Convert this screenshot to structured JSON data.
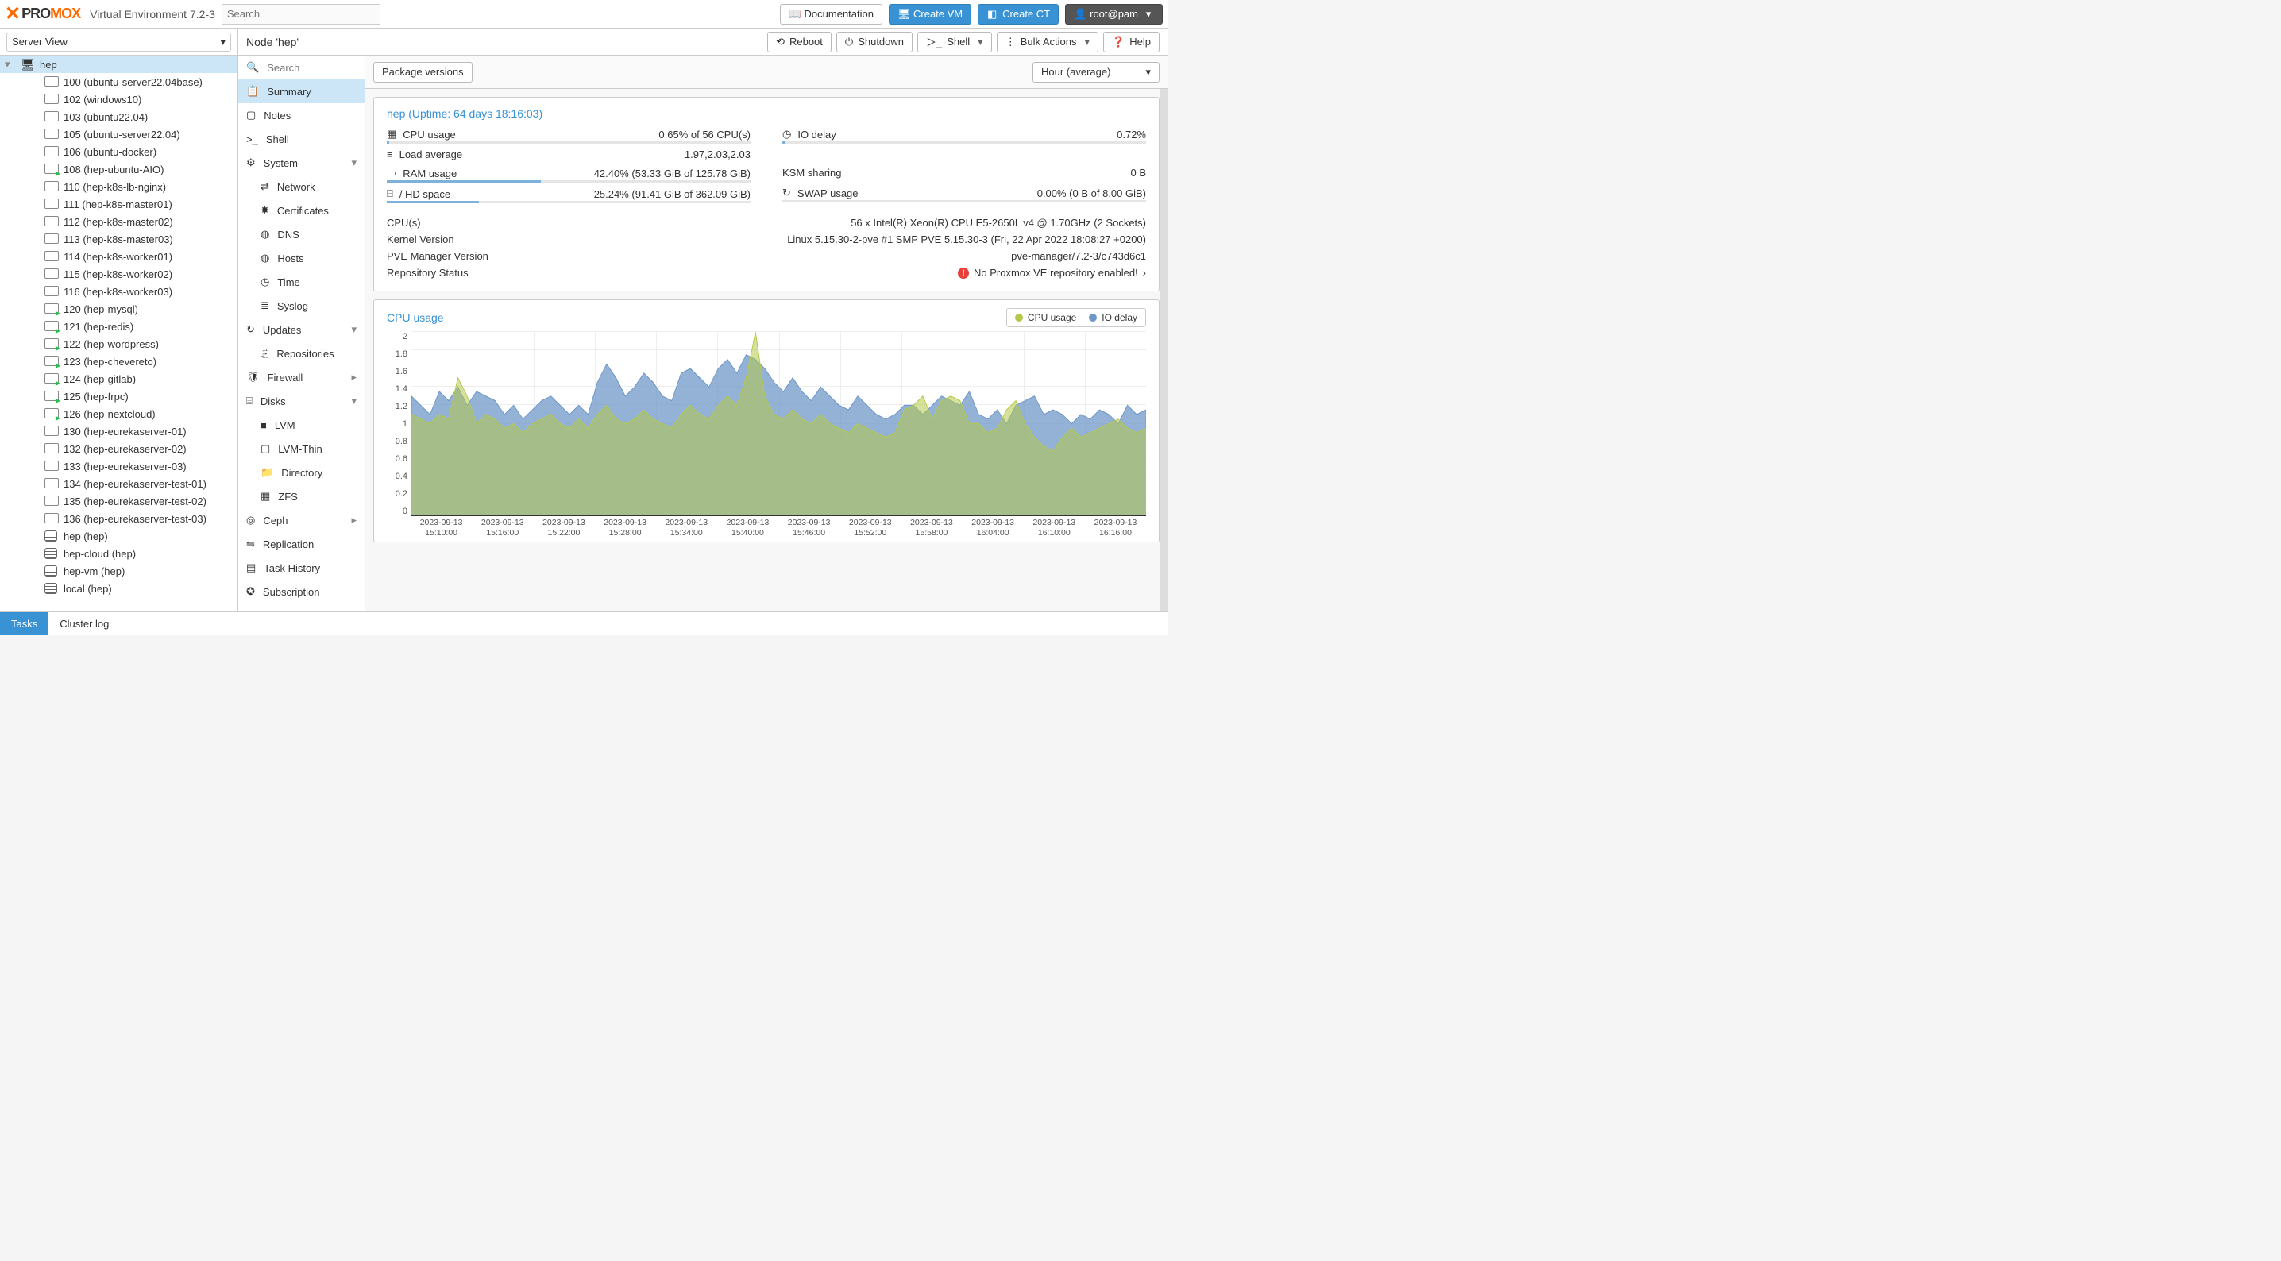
{
  "header": {
    "brand_prox": "PRO",
    "brand_mox": "MOX",
    "product": "Virtual Environment 7.2-3",
    "search_placeholder": "Search",
    "btn_docs": "Documentation",
    "btn_create_vm": "Create VM",
    "btn_create_ct": "Create CT",
    "btn_user": "root@pam"
  },
  "viewbar": {
    "view_select": "Server View",
    "node_title": "Node 'hep'",
    "btn_reboot": "Reboot",
    "btn_shutdown": "Shutdown",
    "btn_shell": "Shell",
    "btn_bulk": "Bulk Actions",
    "btn_help": "Help"
  },
  "tree": {
    "root": "hep",
    "items": [
      {
        "label": "100 (ubuntu-server22.04base)",
        "running": false,
        "type": "vm"
      },
      {
        "label": "102 (windows10)",
        "running": false,
        "type": "vm"
      },
      {
        "label": "103 (ubuntu22.04)",
        "running": false,
        "type": "vm"
      },
      {
        "label": "105 (ubuntu-server22.04)",
        "running": false,
        "type": "vm"
      },
      {
        "label": "106 (ubuntu-docker)",
        "running": false,
        "type": "vm"
      },
      {
        "label": "108 (hep-ubuntu-AIO)",
        "running": true,
        "type": "vm"
      },
      {
        "label": "110 (hep-k8s-lb-nginx)",
        "running": false,
        "type": "vm"
      },
      {
        "label": "111 (hep-k8s-master01)",
        "running": false,
        "type": "vm"
      },
      {
        "label": "112 (hep-k8s-master02)",
        "running": false,
        "type": "vm"
      },
      {
        "label": "113 (hep-k8s-master03)",
        "running": false,
        "type": "vm"
      },
      {
        "label": "114 (hep-k8s-worker01)",
        "running": false,
        "type": "vm"
      },
      {
        "label": "115 (hep-k8s-worker02)",
        "running": false,
        "type": "vm"
      },
      {
        "label": "116 (hep-k8s-worker03)",
        "running": false,
        "type": "vm"
      },
      {
        "label": "120 (hep-mysql)",
        "running": true,
        "type": "vm"
      },
      {
        "label": "121 (hep-redis)",
        "running": true,
        "type": "vm"
      },
      {
        "label": "122 (hep-wordpress)",
        "running": true,
        "type": "vm"
      },
      {
        "label": "123 (hep-chevereto)",
        "running": true,
        "type": "vm"
      },
      {
        "label": "124 (hep-gitlab)",
        "running": true,
        "type": "vm"
      },
      {
        "label": "125 (hep-frpc)",
        "running": true,
        "type": "vm"
      },
      {
        "label": "126 (hep-nextcloud)",
        "running": true,
        "type": "vm"
      },
      {
        "label": "130 (hep-eurekaserver-01)",
        "running": false,
        "type": "vm"
      },
      {
        "label": "132 (hep-eurekaserver-02)",
        "running": false,
        "type": "vm"
      },
      {
        "label": "133 (hep-eurekaserver-03)",
        "running": false,
        "type": "vm"
      },
      {
        "label": "134 (hep-eurekaserver-test-01)",
        "running": false,
        "type": "vm"
      },
      {
        "label": "135 (hep-eurekaserver-test-02)",
        "running": false,
        "type": "vm"
      },
      {
        "label": "136 (hep-eurekaserver-test-03)",
        "running": false,
        "type": "vm"
      },
      {
        "label": "hep (hep)",
        "running": false,
        "type": "storage"
      },
      {
        "label": "hep-cloud (hep)",
        "running": false,
        "type": "storage"
      },
      {
        "label": "hep-vm (hep)",
        "running": false,
        "type": "storage"
      },
      {
        "label": "local (hep)",
        "running": false,
        "type": "storage"
      }
    ]
  },
  "midmenu": {
    "search_placeholder": "Search",
    "items": [
      {
        "label": "Summary",
        "icon": "📋",
        "selected": true
      },
      {
        "label": "Notes",
        "icon": "▢"
      },
      {
        "label": "Shell",
        "icon": ">_"
      },
      {
        "label": "System",
        "icon": "⚙",
        "expand": true
      },
      {
        "label": "Network",
        "icon": "⇄",
        "sub": true
      },
      {
        "label": "Certificates",
        "icon": "✸",
        "sub": true
      },
      {
        "label": "DNS",
        "icon": "◍",
        "sub": true
      },
      {
        "label": "Hosts",
        "icon": "◍",
        "sub": true
      },
      {
        "label": "Time",
        "icon": "◷",
        "sub": true
      },
      {
        "label": "Syslog",
        "icon": "≣",
        "sub": true
      },
      {
        "label": "Updates",
        "icon": "↻",
        "expand": true
      },
      {
        "label": "Repositories",
        "icon": "⎘",
        "sub": true
      },
      {
        "label": "Firewall",
        "icon": "🛡",
        "chev": true
      },
      {
        "label": "Disks",
        "icon": "⌸",
        "expand": true
      },
      {
        "label": "LVM",
        "icon": "■",
        "sub": true
      },
      {
        "label": "LVM-Thin",
        "icon": "▢",
        "sub": true
      },
      {
        "label": "Directory",
        "icon": "📁",
        "sub": true
      },
      {
        "label": "ZFS",
        "icon": "▦",
        "sub": true
      },
      {
        "label": "Ceph",
        "icon": "◎",
        "chev": true
      },
      {
        "label": "Replication",
        "icon": "⇋"
      },
      {
        "label": "Task History",
        "icon": "▤"
      },
      {
        "label": "Subscription",
        "icon": "✪"
      }
    ]
  },
  "toolbar": {
    "pkg_versions": "Package versions",
    "timerange": "Hour (average)"
  },
  "summary": {
    "title": "hep (Uptime: 64 days 18:16:03)",
    "cpu_label": "CPU usage",
    "cpu_value": "0.65% of 56 CPU(s)",
    "cpu_pct": 0.65,
    "load_label": "Load average",
    "load_value": "1.97,2.03,2.03",
    "io_label": "IO delay",
    "io_value": "0.72%",
    "io_pct": 0.72,
    "ram_label": "RAM usage",
    "ram_value": "42.40% (53.33 GiB of 125.78 GiB)",
    "ram_pct": 42.4,
    "hd_label": "/ HD space",
    "hd_value": "25.24% (91.41 GiB of 362.09 GiB)",
    "hd_pct": 25.24,
    "ksm_label": "KSM sharing",
    "ksm_value": "0 B",
    "swap_label": "SWAP usage",
    "swap_value": "0.00% (0 B of 8.00 GiB)",
    "swap_pct": 0,
    "info": [
      {
        "k": "CPU(s)",
        "v": "56 x Intel(R) Xeon(R) CPU E5-2650L v4 @ 1.70GHz (2 Sockets)"
      },
      {
        "k": "Kernel Version",
        "v": "Linux 5.15.30-2-pve #1 SMP PVE 5.15.30-3 (Fri, 22 Apr 2022 18:08:27 +0200)"
      },
      {
        "k": "PVE Manager Version",
        "v": "pve-manager/7.2-3/c743d6c1"
      }
    ],
    "repo_label": "Repository Status",
    "repo_value": "No Proxmox VE repository enabled!"
  },
  "chart_data": {
    "type": "area",
    "title": "CPU usage",
    "ylabel": "",
    "ylim": [
      0,
      2
    ],
    "yticks": [
      2,
      1.8,
      1.6,
      1.4,
      1.2,
      1,
      0.8,
      0.6,
      0.4,
      0.2,
      0
    ],
    "x_labels": [
      "2023-09-13\n15:10:00",
      "2023-09-13\n15:16:00",
      "2023-09-13\n15:22:00",
      "2023-09-13\n15:28:00",
      "2023-09-13\n15:34:00",
      "2023-09-13\n15:40:00",
      "2023-09-13\n15:46:00",
      "2023-09-13\n15:52:00",
      "2023-09-13\n15:58:00",
      "2023-09-13\n16:04:00",
      "2023-09-13\n16:10:00",
      "2023-09-13\n16:16:00"
    ],
    "series": [
      {
        "name": "IO delay",
        "color": "#6f98c8",
        "values": [
          1.3,
          1.2,
          1.1,
          1.35,
          1.25,
          1.4,
          1.2,
          1.35,
          1.3,
          1.25,
          1.1,
          1.2,
          1.05,
          1.15,
          1.25,
          1.3,
          1.2,
          1.1,
          1.2,
          1.1,
          1.45,
          1.65,
          1.5,
          1.3,
          1.4,
          1.55,
          1.45,
          1.3,
          1.25,
          1.55,
          1.6,
          1.5,
          1.4,
          1.6,
          1.7,
          1.55,
          1.75,
          1.7,
          1.6,
          1.45,
          1.35,
          1.5,
          1.35,
          1.25,
          1.4,
          1.3,
          1.2,
          1.15,
          1.3,
          1.2,
          1.1,
          1.05,
          1.1,
          1.2,
          1.2,
          1.1,
          1.2,
          1.3,
          1.25,
          1.2,
          1.35,
          1.1,
          1.05,
          1.15,
          1.0,
          1.2,
          1.25,
          1.3,
          1.1,
          1.15,
          1.1,
          1.0,
          1.1,
          1.05,
          1.15,
          1.1,
          1.0,
          1.2,
          1.1,
          1.15
        ]
      },
      {
        "name": "CPU usage",
        "color": "#b4c94a",
        "values": [
          1.1,
          1.05,
          1.0,
          1.1,
          1.05,
          1.5,
          1.3,
          1.0,
          1.1,
          1.05,
          0.95,
          1.0,
          0.9,
          1.0,
          1.05,
          1.1,
          1.0,
          0.95,
          1.05,
          0.95,
          1.1,
          1.2,
          1.05,
          1.0,
          1.05,
          1.15,
          1.05,
          1.0,
          0.95,
          1.1,
          1.2,
          1.1,
          1.05,
          1.2,
          1.3,
          1.2,
          1.5,
          2.0,
          1.3,
          1.1,
          1.05,
          1.15,
          1.05,
          1.0,
          1.1,
          1.0,
          0.95,
          0.9,
          1.0,
          0.95,
          0.9,
          0.85,
          0.9,
          1.15,
          1.2,
          1.3,
          1.05,
          1.25,
          1.3,
          1.25,
          1.0,
          1.0,
          0.9,
          0.95,
          1.15,
          1.25,
          1.0,
          0.85,
          0.75,
          0.7,
          0.85,
          0.95,
          0.85,
          0.9,
          0.95,
          1.0,
          1.05,
          0.95,
          0.9,
          0.95
        ]
      }
    ],
    "legend": [
      {
        "name": "CPU usage",
        "color": "#b4c94a"
      },
      {
        "name": "IO delay",
        "color": "#6f98c8"
      }
    ]
  },
  "footer": {
    "tasks": "Tasks",
    "cluster_log": "Cluster log"
  }
}
